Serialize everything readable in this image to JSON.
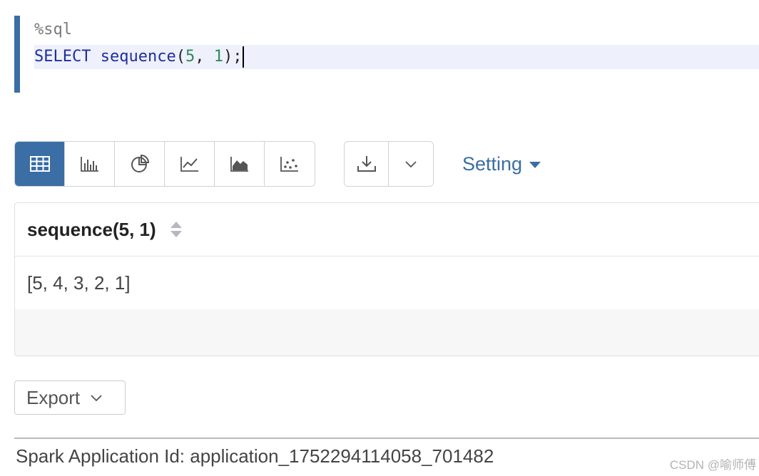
{
  "editor": {
    "magic": "%sql",
    "code": {
      "keyword": "SELECT",
      "function": "sequence",
      "open": "(",
      "arg1": "5",
      "sep": ", ",
      "arg2": "1",
      "close": ");"
    }
  },
  "toolbar": {
    "views": [
      {
        "icon": "table-icon",
        "active": true
      },
      {
        "icon": "bar-chart-icon",
        "active": false
      },
      {
        "icon": "pie-chart-icon",
        "active": false
      },
      {
        "icon": "line-chart-icon",
        "active": false
      },
      {
        "icon": "area-chart-icon",
        "active": false
      },
      {
        "icon": "scatter-chart-icon",
        "active": false
      }
    ],
    "download_icon": "download-icon",
    "dropdown_icon": "chevron-down-icon",
    "setting_label": "Setting",
    "accent": "#3a6ea5"
  },
  "table": {
    "column": "sequence(5, 1)",
    "rows": [
      [
        "[5, 4, 3, 2, 1]"
      ]
    ]
  },
  "export": {
    "label": "Export"
  },
  "footer": {
    "app_id": "Spark Application Id: application_1752294114058_701482",
    "watermark": "CSDN @喻师傅"
  }
}
